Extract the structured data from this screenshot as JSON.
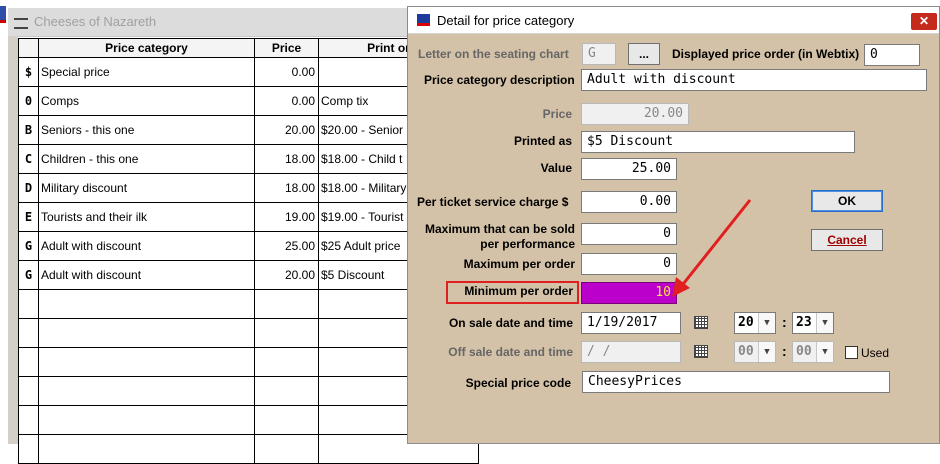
{
  "bg_window": {
    "title": "Cheeses of Nazareth",
    "columns": [
      "",
      "Price category",
      "Price",
      "Print on tix"
    ],
    "rows": [
      {
        "letter": "$",
        "category": "Special price",
        "price": "0.00",
        "print": ""
      },
      {
        "letter": "0",
        "category": "Comps",
        "price": "0.00",
        "print": "Comp tix"
      },
      {
        "letter": "B",
        "category": "Seniors - this one",
        "price": "20.00",
        "print": "$20.00 - Senior"
      },
      {
        "letter": "C",
        "category": "Children - this one",
        "price": "18.00",
        "print": "$18.00 - Child t"
      },
      {
        "letter": "D",
        "category": "Military discount",
        "price": "18.00",
        "print": "$18.00 - Military"
      },
      {
        "letter": "E",
        "category": "Tourists and their ilk",
        "price": "19.00",
        "print": "$19.00 - Tourist"
      },
      {
        "letter": "G",
        "category": "Adult with discount",
        "price": "25.00",
        "print": "$25 Adult price"
      },
      {
        "letter": "G",
        "category": "Adult with discount",
        "price": "20.00",
        "print": "$5 Discount"
      }
    ],
    "empty_rows": 6
  },
  "dialog": {
    "title": "Detail for price category",
    "close_label": "✕",
    "labels": {
      "letter": "Letter on the seating chart",
      "displayed_order": "Displayed price order (in Webtix)",
      "description": "Price category description",
      "price": "Price",
      "printed_as": "Printed as",
      "value": "Value",
      "service_charge": "Per ticket service charge  $",
      "max_sold_line1": "Maximum that can be sold",
      "max_sold_line2": "per performance",
      "max_order": "Maximum per order",
      "min_order": "Minimum per order",
      "on_sale": "On sale date and time",
      "off_sale": "Off sale date and time",
      "special_code": "Special price code",
      "used": "Used"
    },
    "values": {
      "letter": "G",
      "ellipsis_button": "...",
      "displayed_order": "0",
      "description": "Adult with discount",
      "price": "20.00",
      "printed_as": "$5 Discount",
      "value": "25.00",
      "service_charge": "0.00",
      "max_sold": "0",
      "max_order": "0",
      "min_order": "10",
      "on_sale_date": "1/19/2017",
      "on_sale_hour": "20",
      "on_sale_minute": "23",
      "off_sale_date": " / /",
      "off_sale_hour": "00",
      "off_sale_minute": "00",
      "special_code": "CheesyPrices"
    },
    "buttons": {
      "ok": "OK",
      "cancel": "Cancel"
    }
  },
  "colors": {
    "dialog_bg": "#d4c2a8",
    "highlight_field": "#bb00cc",
    "highlight_text": "#ffe040",
    "annotation_red": "#e02020",
    "close_button": "#c42b1c"
  }
}
